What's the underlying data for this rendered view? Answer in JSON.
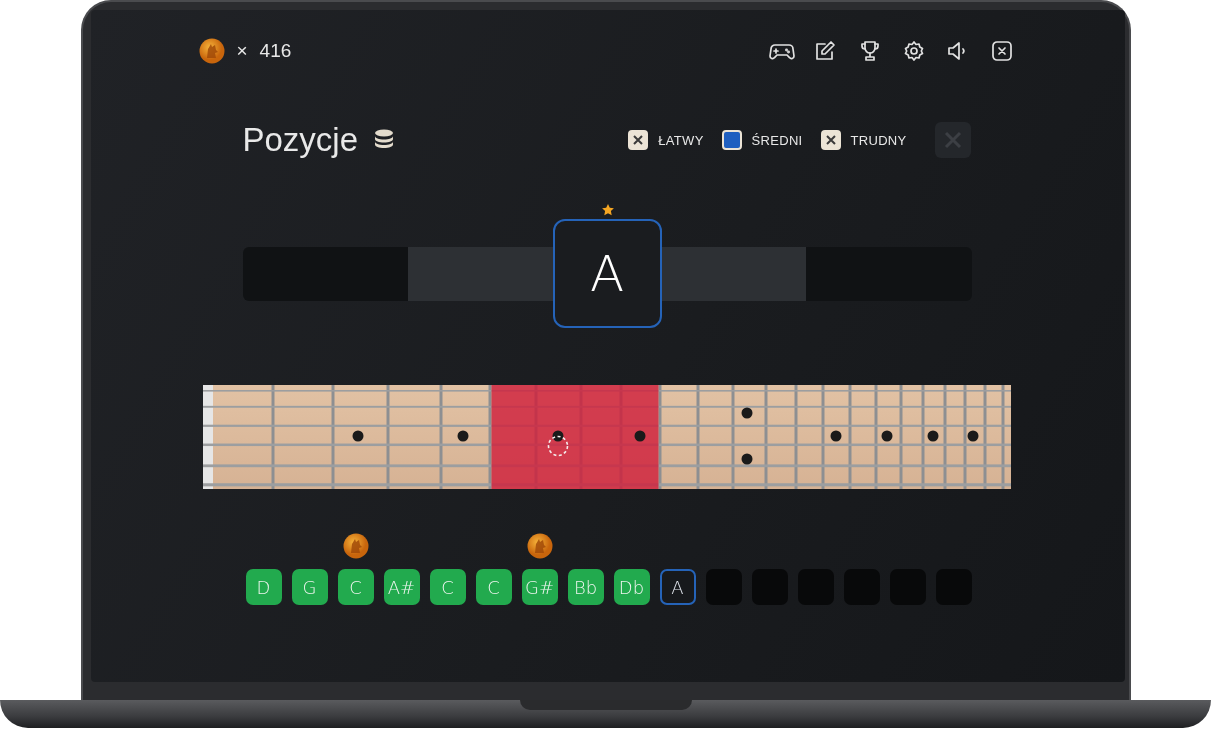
{
  "coins": {
    "multiplier": "×",
    "count": "416"
  },
  "title": "Pozycje",
  "difficulty": [
    {
      "label": "ŁATWY",
      "checked": true
    },
    {
      "label": "ŚREDNI",
      "checked": false
    },
    {
      "label": "TRUDNY",
      "checked": true
    }
  ],
  "current_note": {
    "label": "A"
  },
  "answers": [
    {
      "kind": "correct",
      "label": "D",
      "coin": false
    },
    {
      "kind": "correct",
      "label": "G",
      "coin": false
    },
    {
      "kind": "correct",
      "label": "C",
      "coin": true
    },
    {
      "kind": "correct",
      "label": "A#",
      "coin": false
    },
    {
      "kind": "correct",
      "label": "C",
      "coin": false
    },
    {
      "kind": "correct",
      "label": "C",
      "coin": false
    },
    {
      "kind": "correct",
      "label": "G#",
      "coin": true
    },
    {
      "kind": "correct",
      "label": "Bb",
      "coin": false
    },
    {
      "kind": "correct",
      "label": "Db",
      "coin": false
    },
    {
      "kind": "current",
      "label": "A",
      "coin": false
    },
    {
      "kind": "empty",
      "coin": false
    },
    {
      "kind": "empty",
      "coin": false
    },
    {
      "kind": "empty",
      "coin": false
    },
    {
      "kind": "empty",
      "coin": false
    },
    {
      "kind": "empty",
      "coin": false
    },
    {
      "kind": "empty",
      "coin": false
    }
  ]
}
